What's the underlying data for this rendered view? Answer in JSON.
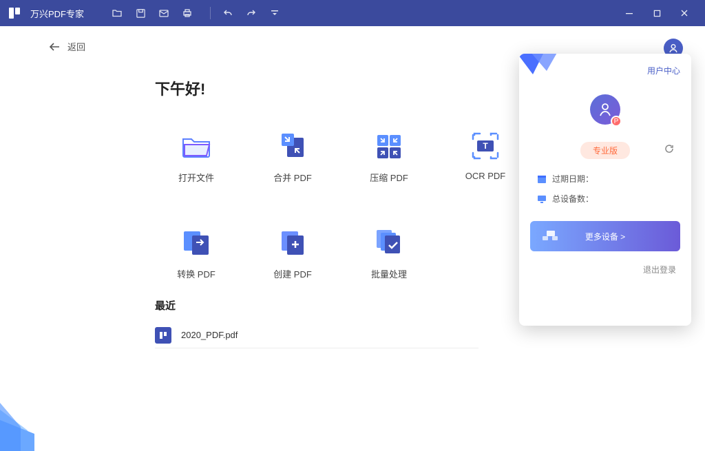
{
  "titlebar": {
    "appTitle": "万兴PDF专家"
  },
  "back": {
    "label": "返回"
  },
  "greeting": "下午好!",
  "actions": {
    "open": {
      "label": "打开文件"
    },
    "merge": {
      "label": "合并 PDF"
    },
    "compress": {
      "label": "压缩 PDF"
    },
    "ocr": {
      "label": "OCR PDF"
    },
    "convert": {
      "label": "转换 PDF"
    },
    "create": {
      "label": "创建 PDF"
    },
    "batch": {
      "label": "批量处理"
    }
  },
  "recent": {
    "title": "最近",
    "items": [
      {
        "name": "2020_PDF.pdf"
      }
    ]
  },
  "panel": {
    "center": "用户中心",
    "badgeLetter": "P",
    "proLabel": "专业版",
    "expire": "过期日期：",
    "devices": "总设备数：",
    "moreBtn": "更多设备 >",
    "logout": "退出登录"
  }
}
